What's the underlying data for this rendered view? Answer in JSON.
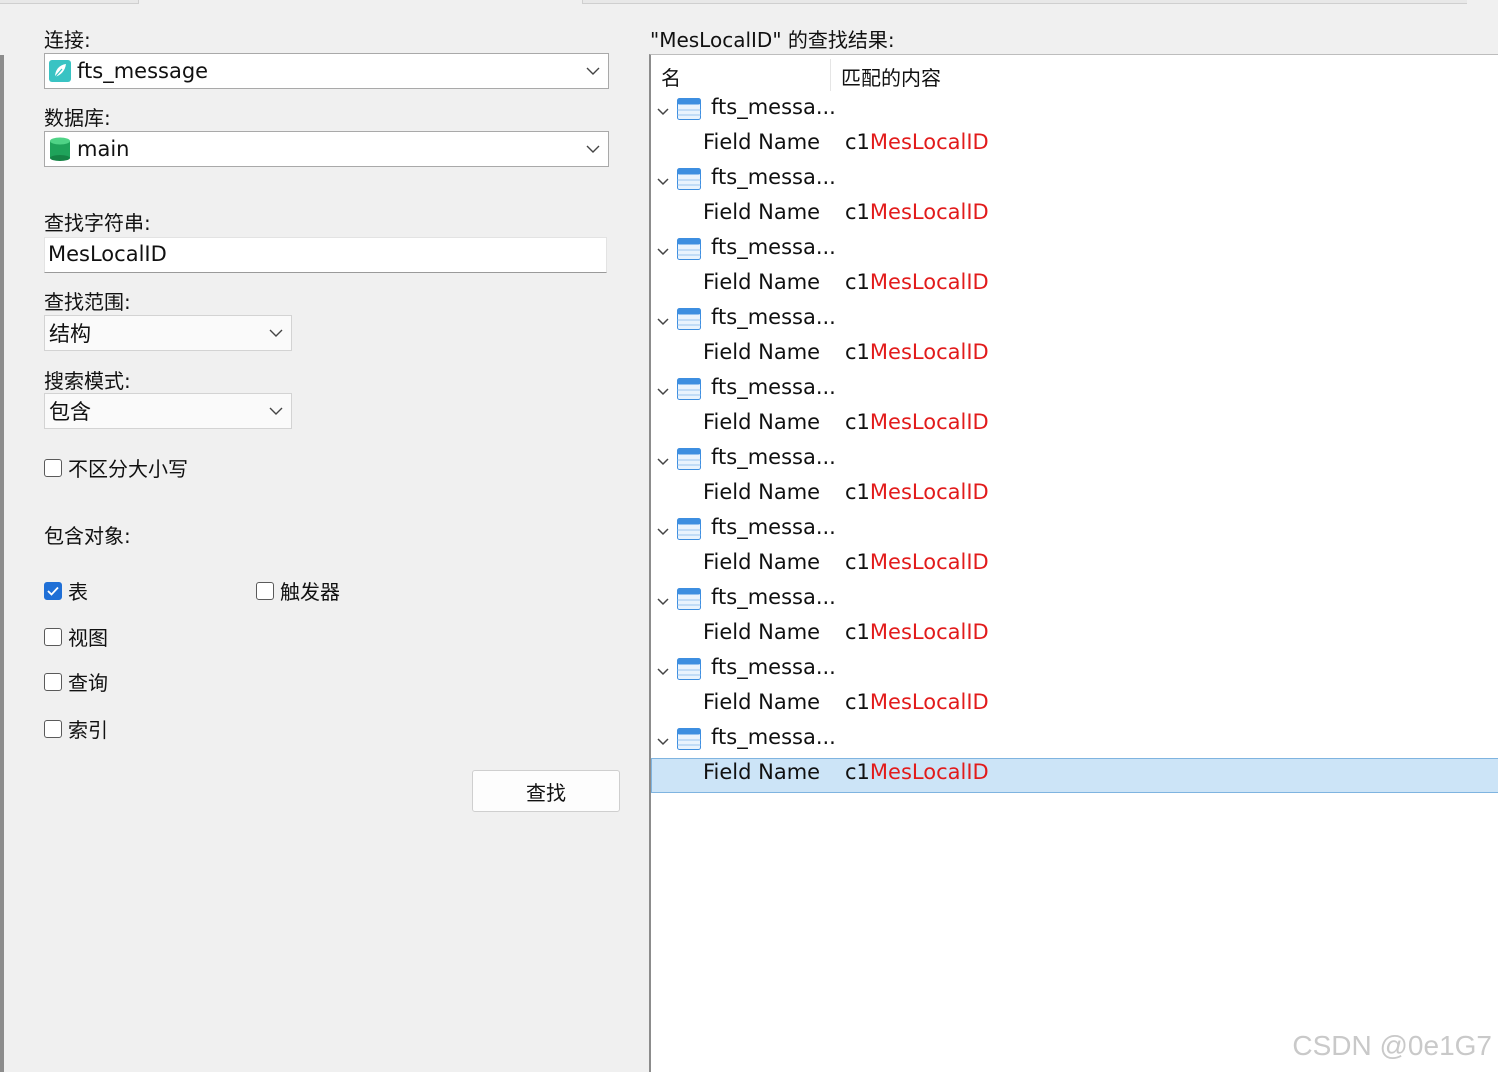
{
  "form": {
    "connection_label": "连接:",
    "connection_value": "fts_message",
    "database_label": "数据库:",
    "database_value": "main",
    "search_string_label": "查找字符串:",
    "search_string_value": "MesLocalID",
    "search_scope_label": "查找范围:",
    "search_scope_value": "结构",
    "search_mode_label": "搜索模式:",
    "search_mode_value": "包含",
    "case_insensitive_label": "不区分大小写",
    "case_insensitive_checked": false,
    "include_objects_label": "包含对象:",
    "objects": {
      "table": {
        "label": "表",
        "checked": true
      },
      "trigger": {
        "label": "触发器",
        "checked": false
      },
      "view": {
        "label": "视图",
        "checked": false
      },
      "query": {
        "label": "查询",
        "checked": false
      },
      "index": {
        "label": "索引",
        "checked": false
      }
    },
    "find_button": "查找"
  },
  "results": {
    "title": "\"MesLocalID\" 的查找结果:",
    "col_name": "名",
    "col_match": "匹配的内容",
    "groups": [
      {
        "table": "fts_messa...",
        "field_label": "Field Name",
        "prefix": "c1",
        "highlight": "MesLocalID"
      },
      {
        "table": "fts_messa...",
        "field_label": "Field Name",
        "prefix": "c1",
        "highlight": "MesLocalID"
      },
      {
        "table": "fts_messa...",
        "field_label": "Field Name",
        "prefix": "c1",
        "highlight": "MesLocalID"
      },
      {
        "table": "fts_messa...",
        "field_label": "Field Name",
        "prefix": "c1",
        "highlight": "MesLocalID"
      },
      {
        "table": "fts_messa...",
        "field_label": "Field Name",
        "prefix": "c1",
        "highlight": "MesLocalID"
      },
      {
        "table": "fts_messa...",
        "field_label": "Field Name",
        "prefix": "c1",
        "highlight": "MesLocalID"
      },
      {
        "table": "fts_messa...",
        "field_label": "Field Name",
        "prefix": "c1",
        "highlight": "MesLocalID"
      },
      {
        "table": "fts_messa...",
        "field_label": "Field Name",
        "prefix": "c1",
        "highlight": "MesLocalID"
      },
      {
        "table": "fts_messa...",
        "field_label": "Field Name",
        "prefix": "c1",
        "highlight": "MesLocalID"
      },
      {
        "table": "fts_messa...",
        "field_label": "Field Name",
        "prefix": "c1",
        "highlight": "MesLocalID"
      }
    ],
    "selected_group_index": 9
  },
  "watermark": "CSDN @0e1G7",
  "colors": {
    "highlight": "#e21b1b",
    "checkbox_checked": "#1f6fd6",
    "selection": "#cce4f7"
  }
}
